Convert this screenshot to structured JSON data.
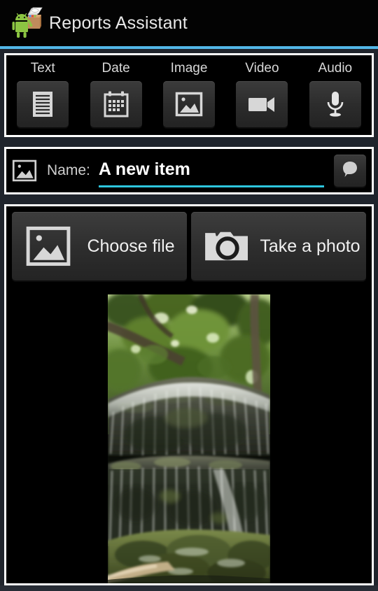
{
  "titlebar": {
    "app_icon_name": "android-package-icon",
    "title": "Reports Assistant",
    "accent_color": "#53b7e8",
    "background_color": "#030303"
  },
  "type_tabs": [
    {
      "label": "Text",
      "icon": "document-icon"
    },
    {
      "label": "Date",
      "icon": "calendar-icon"
    },
    {
      "label": "Image",
      "icon": "picture-icon"
    },
    {
      "label": "Video",
      "icon": "video-camera-icon"
    },
    {
      "label": "Audio",
      "icon": "microphone-icon"
    }
  ],
  "name_row": {
    "type_icon": "picture-icon",
    "label": "Name:",
    "value": "A new item",
    "placeholder": "Name",
    "underline_color": "#2ec6de",
    "comment_button_icon": "speech-bubble-icon"
  },
  "actions": [
    {
      "label": "Choose file",
      "icon": "picture-icon"
    },
    {
      "label": "Take a photo",
      "icon": "camera-icon"
    }
  ],
  "preview": {
    "name": "waterfall-photo",
    "alt": "Photograph of a multi-tiered waterfall over mossy rock with green trees above"
  },
  "chrome": {
    "panel_border_color": "#ffffff",
    "panel_background": "#000000",
    "page_background": "#272c35"
  }
}
